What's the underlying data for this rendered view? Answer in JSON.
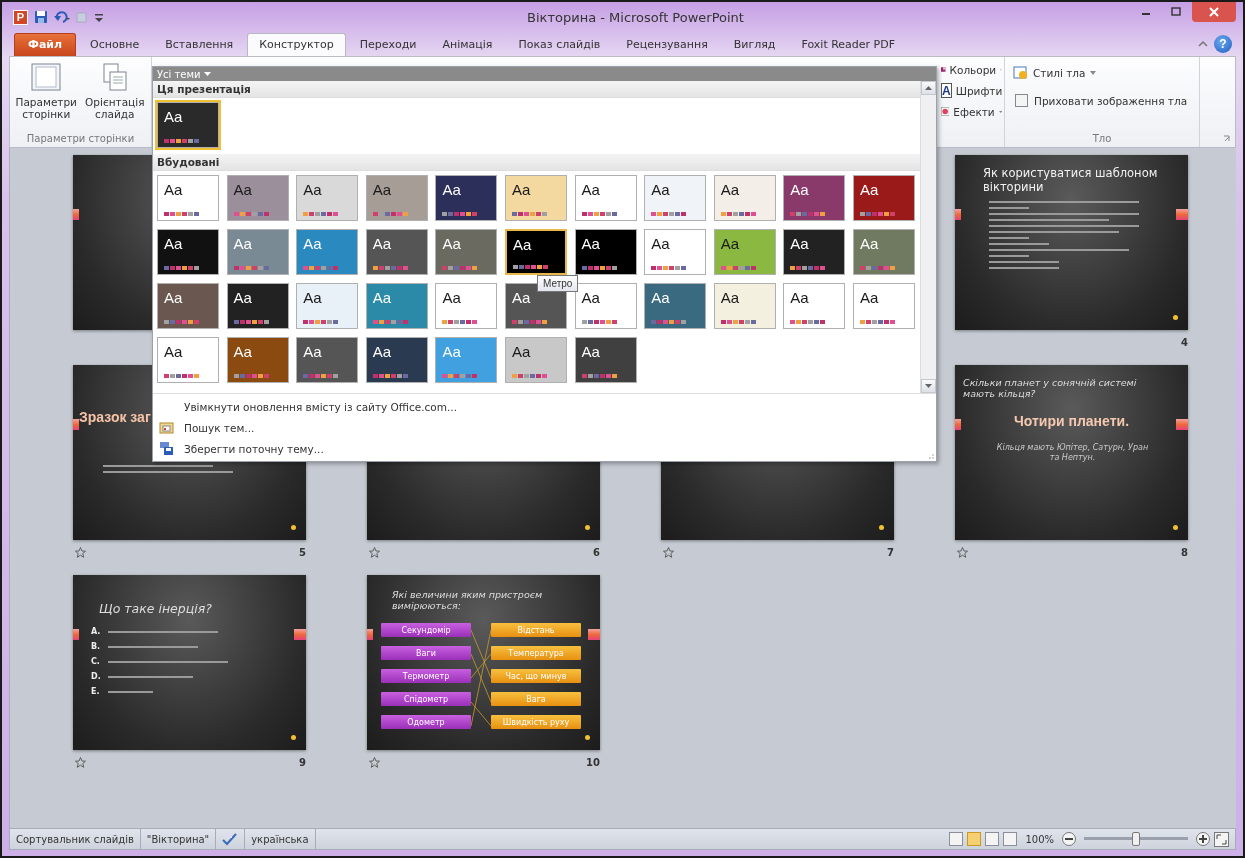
{
  "window": {
    "app_icon": "P",
    "title": "Вікторина - Microsoft PowerPoint",
    "help": "?"
  },
  "tabs": [
    {
      "label": "Файл",
      "kind": "file",
      "selected": false
    },
    {
      "label": "Основне",
      "kind": "tab",
      "selected": false
    },
    {
      "label": "Вставлення",
      "kind": "tab",
      "selected": false
    },
    {
      "label": "Конструктор",
      "kind": "tab",
      "selected": true
    },
    {
      "label": "Переходи",
      "kind": "tab",
      "selected": false
    },
    {
      "label": "Анімація",
      "kind": "tab",
      "selected": false
    },
    {
      "label": "Показ слайдів",
      "kind": "tab",
      "selected": false
    },
    {
      "label": "Рецензування",
      "kind": "tab",
      "selected": false
    },
    {
      "label": "Вигляд",
      "kind": "tab",
      "selected": false
    },
    {
      "label": "Foxit Reader PDF",
      "kind": "tab",
      "selected": false
    }
  ],
  "ribbon": {
    "page_setup": {
      "buttons": [
        {
          "label": "Параметри сторінки",
          "kind": "page"
        },
        {
          "label": "Орієнтація слайда",
          "kind": "orientation"
        }
      ],
      "group_label": "Параметри сторінки"
    },
    "theme_options": [
      {
        "label": "Кольори",
        "kind": "colors"
      },
      {
        "label": "Шрифти",
        "kind": "fonts",
        "glyph": "A"
      },
      {
        "label": "Ефекти",
        "kind": "effects"
      }
    ],
    "background": {
      "styles_button": "Стилі тла",
      "hide_graphics": {
        "label": "Приховати зображення тла",
        "checked": false
      },
      "group_label": "Тло"
    }
  },
  "theme_gallery": {
    "filter": "Усі теми",
    "tooltip": "Метро",
    "sections": [
      {
        "title": "Ця презентація",
        "themes": [
          {
            "label": "Aa",
            "color": "#2a2a2a",
            "selected": true,
            "hovered": false
          }
        ]
      },
      {
        "title": "Вбудовані",
        "themes": [
          {
            "label": "Aa",
            "color": "#ffffff",
            "selected": false,
            "hovered": false
          },
          {
            "label": "Aa",
            "color": "#9a8f9a",
            "selected": false,
            "hovered": false
          },
          {
            "label": "Aa",
            "color": "#d9d9d9",
            "selected": false,
            "hovered": false
          },
          {
            "label": "Aa",
            "color": "#a79d97",
            "selected": false,
            "hovered": false
          },
          {
            "label": "Aa",
            "color": "#2b2f5a",
            "selected": false,
            "hovered": false
          },
          {
            "label": "Aa",
            "color": "#f3d9a0",
            "selected": false,
            "hovered": false
          },
          {
            "label": "Aa",
            "color": "#ffffff",
            "selected": false,
            "hovered": false
          },
          {
            "label": "Aa",
            "color": "#f0f4f8",
            "selected": false,
            "hovered": false
          },
          {
            "label": "Aa",
            "color": "#f4eee8",
            "selected": false,
            "hovered": false
          },
          {
            "label": "Aa",
            "color": "#8a3a6a",
            "selected": false,
            "hovered": false
          },
          {
            "label": "Aa",
            "color": "#9a1a1a",
            "selected": false,
            "hovered": false
          },
          {
            "label": "Aa",
            "color": "#111111",
            "selected": false,
            "hovered": false
          },
          {
            "label": "Aa",
            "color": "#7a8a95",
            "selected": false,
            "hovered": false
          },
          {
            "label": "Aa",
            "color": "#2a8ac0",
            "selected": false,
            "hovered": false
          },
          {
            "label": "Aa",
            "color": "#555555",
            "selected": false,
            "hovered": false
          },
          {
            "label": "Aa",
            "color": "#6a6a60",
            "selected": false,
            "hovered": false
          },
          {
            "label": "Aa",
            "color": "#000000",
            "selected": false,
            "hovered": true
          },
          {
            "label": "Aa",
            "color": "#000000",
            "selected": false,
            "hovered": false
          },
          {
            "label": "Aa",
            "color": "#ffffff",
            "selected": false,
            "hovered": false
          },
          {
            "label": "Aa",
            "color": "#8ab840",
            "selected": false,
            "hovered": false
          },
          {
            "label": "Aa",
            "color": "#222222",
            "selected": false,
            "hovered": false
          },
          {
            "label": "Aa",
            "color": "#707a60",
            "selected": false,
            "hovered": false
          },
          {
            "label": "Aa",
            "color": "#6a5850",
            "selected": false,
            "hovered": false
          },
          {
            "label": "Aa",
            "color": "#222222",
            "selected": false,
            "hovered": false
          },
          {
            "label": "Aa",
            "color": "#e8f0f8",
            "selected": false,
            "hovered": false
          },
          {
            "label": "Aa",
            "color": "#2a8aa8",
            "selected": false,
            "hovered": false
          },
          {
            "label": "Aa",
            "color": "#ffffff",
            "selected": false,
            "hovered": false
          },
          {
            "label": "Aa",
            "color": "#555555",
            "selected": false,
            "hovered": false
          },
          {
            "label": "Aa",
            "color": "#ffffff",
            "selected": false,
            "hovered": false
          },
          {
            "label": "Aa",
            "color": "#3a6a80",
            "selected": false,
            "hovered": false
          },
          {
            "label": "Aa",
            "color": "#f4f0e0",
            "selected": false,
            "hovered": false
          },
          {
            "label": "Aa",
            "color": "#ffffff",
            "selected": false,
            "hovered": false
          },
          {
            "label": "Aa",
            "color": "#ffffff",
            "selected": false,
            "hovered": false
          },
          {
            "label": "Aa",
            "color": "#ffffff",
            "selected": false,
            "hovered": false
          },
          {
            "label": "Aa",
            "color": "#8a4a10",
            "selected": false,
            "hovered": false
          },
          {
            "label": "Aa",
            "color": "#555555",
            "selected": false,
            "hovered": false
          },
          {
            "label": "Aa",
            "color": "#2a3a50",
            "selected": false,
            "hovered": false
          },
          {
            "label": "Aa",
            "color": "#40a0e0",
            "selected": false,
            "hovered": false
          },
          {
            "label": "Aa",
            "color": "#c8c8c8",
            "selected": false,
            "hovered": false
          },
          {
            "label": "Aa",
            "color": "#404040",
            "selected": false,
            "hovered": false
          }
        ]
      }
    ],
    "menu": [
      {
        "label": "Увімкнути оновлення вмісту із сайту Office.com...",
        "kind": "plain"
      },
      {
        "label": "Пошук тем...",
        "kind": "browse"
      },
      {
        "label": "Зберегти поточну тему...",
        "kind": "save"
      }
    ]
  },
  "slides": [
    {
      "kind": "plain",
      "accent_left": true,
      "accent_right": false,
      "transition": false
    },
    {
      "kind": "covered"
    },
    {
      "kind": "covered"
    },
    {
      "kind": "bullets",
      "accent_left": true,
      "accent_right": true,
      "title": "Як користуватися шаблоном вікторини",
      "number": "4",
      "transition": false
    },
    {
      "kind": "intro",
      "accent_left": true,
      "accent_right": false,
      "title": "Зразок заг",
      "number": "5",
      "transition": true
    },
    {
      "kind": "plain",
      "accent_left": false,
      "accent_right": false,
      "number": "6",
      "transition": true
    },
    {
      "kind": "plain",
      "accent_left": false,
      "accent_right": false,
      "number": "7",
      "transition": true
    },
    {
      "kind": "statement",
      "accent_left": true,
      "accent_right": true,
      "title": "Скільки планет у сонячній системі мають кільця?",
      "headline": "Чотири планети.",
      "caption": "Кільця мають Юпітер, Сатурн, Уран та Нептун.",
      "number": "8",
      "transition": true
    },
    {
      "kind": "quiz",
      "accent_left": true,
      "accent_right": true,
      "title": "Що таке інерція?",
      "options": [
        "A.",
        "B.",
        "C.",
        "D.",
        "E."
      ],
      "number": "9",
      "transition": true
    },
    {
      "kind": "matching",
      "accent_left": true,
      "accent_right": true,
      "title": "Які величини яким пристроєм вимірюються:",
      "left": [
        "Секундомір",
        "Ваги",
        "Термометр",
        "Спідометр",
        "Одометр"
      ],
      "right": [
        "Відстань",
        "Температура",
        "Час, що минув",
        "Вага",
        "Швидкість руху"
      ],
      "number": "10",
      "transition": true
    }
  ],
  "status_bar": {
    "view": "Сортувальник слайдів",
    "theme": "\"Вікторина\"",
    "language": "українська",
    "views": [
      {
        "selected": false
      },
      {
        "selected": true
      },
      {
        "selected": false
      },
      {
        "selected": false
      }
    ],
    "zoom": "100%",
    "zoom_slider": {
      "level": 0.5
    }
  }
}
